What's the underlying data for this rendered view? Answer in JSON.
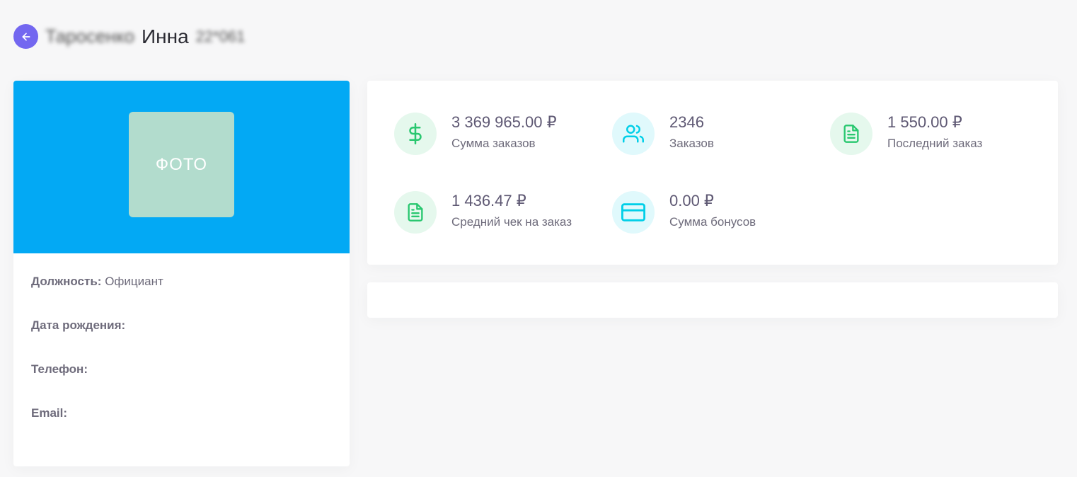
{
  "header": {
    "surname_blurred": "Таросенко",
    "first_name": "Инна",
    "suffix_blurred": "22*061"
  },
  "profile": {
    "photo_placeholder": "ФОТО",
    "fields": [
      {
        "label": "Должность:",
        "value": "Официант"
      },
      {
        "label": "Дата рождения:",
        "value": ""
      },
      {
        "label": "Телефон:",
        "value": ""
      },
      {
        "label": "Email:",
        "value": ""
      }
    ]
  },
  "stats": [
    {
      "icon": "dollar-icon",
      "value": "3 369 965.00 ₽",
      "label": "Сумма заказов"
    },
    {
      "icon": "users-icon",
      "value": "2346",
      "label": "Заказов"
    },
    {
      "icon": "document-icon",
      "value": "1 550.00 ₽",
      "label": "Последний заказ"
    },
    {
      "icon": "document-icon",
      "value": "1 436.47 ₽",
      "label": "Средний чек на заказ"
    },
    {
      "icon": "credit-card-icon",
      "value": "0.00 ₽",
      "label": "Сумма бонусов"
    }
  ],
  "colors": {
    "accent": "#7367f0",
    "banner": "#03a9f4",
    "photo_bg": "#b2dccd",
    "success": "#28c76f",
    "info": "#00cfe8"
  }
}
